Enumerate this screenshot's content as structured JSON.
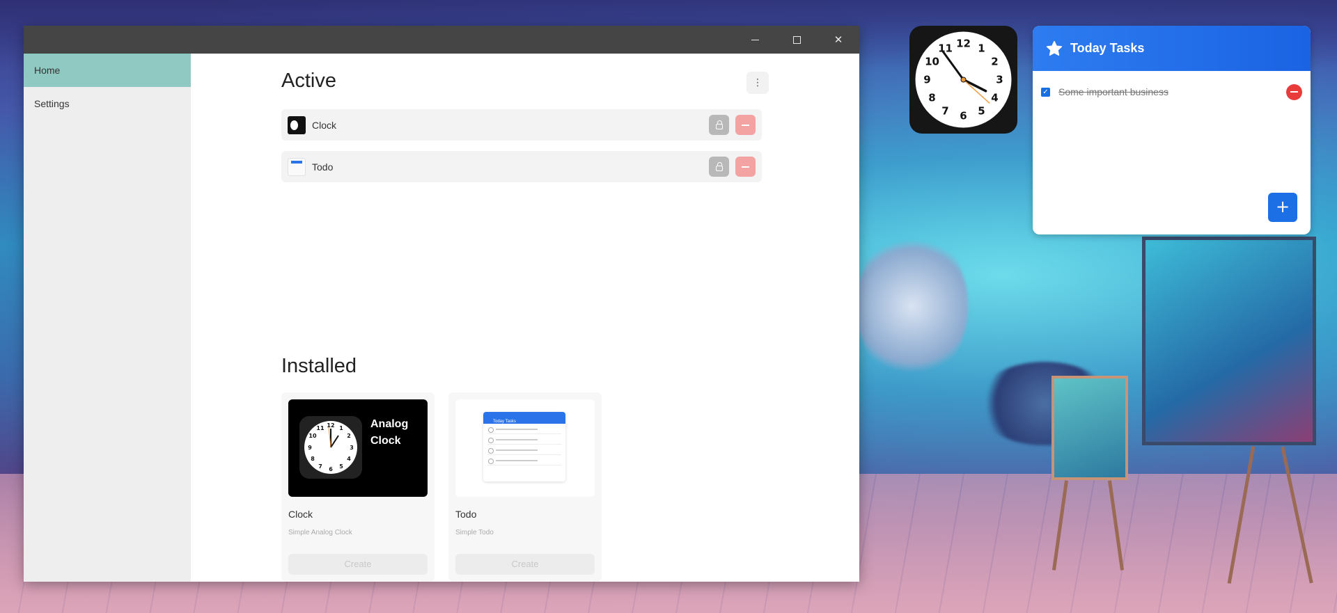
{
  "window": {
    "controls": {
      "minimize": "minimize-icon",
      "maximize": "maximize-icon",
      "close": "close-icon"
    }
  },
  "sidebar": {
    "items": [
      {
        "label": "Home",
        "active": true
      },
      {
        "label": "Settings",
        "active": false
      }
    ]
  },
  "active_section": {
    "title": "Active",
    "menu_icon": "more-vertical-icon",
    "widgets": [
      {
        "name": "Clock",
        "icon": "clock-thumbnail",
        "lock_icon": "lock-icon",
        "remove_icon": "minus-icon"
      },
      {
        "name": "Todo",
        "icon": "todo-thumbnail",
        "lock_icon": "lock-icon",
        "remove_icon": "minus-icon"
      }
    ]
  },
  "installed_section": {
    "title": "Installed",
    "cards": [
      {
        "name": "Clock",
        "description": "Simple Analog Clock",
        "preview_title_line1": "Analog",
        "preview_title_line2": "Clock",
        "create_label": "Create"
      },
      {
        "name": "Todo",
        "description": "Simple Todo",
        "preview_header": "Today Tasks",
        "create_label": "Create"
      }
    ]
  },
  "desktop_clock": {
    "numbers": [
      "12",
      "1",
      "2",
      "3",
      "4",
      "5",
      "6",
      "7",
      "8",
      "9",
      "10",
      "11"
    ],
    "time": {
      "hour": 3,
      "minute": 54,
      "second": 22
    }
  },
  "today_tasks": {
    "title": "Today Tasks",
    "header_icon": "star-icon",
    "tasks": [
      {
        "text": "Some important business",
        "done": true
      }
    ],
    "add_label": "+"
  },
  "colors": {
    "titlebar": "#454545",
    "sidebar_active": "#8fc9c1",
    "accent_blue": "#1d6fe6",
    "danger": "#ea3b3b",
    "remove_soft": "#f4a3a3"
  }
}
